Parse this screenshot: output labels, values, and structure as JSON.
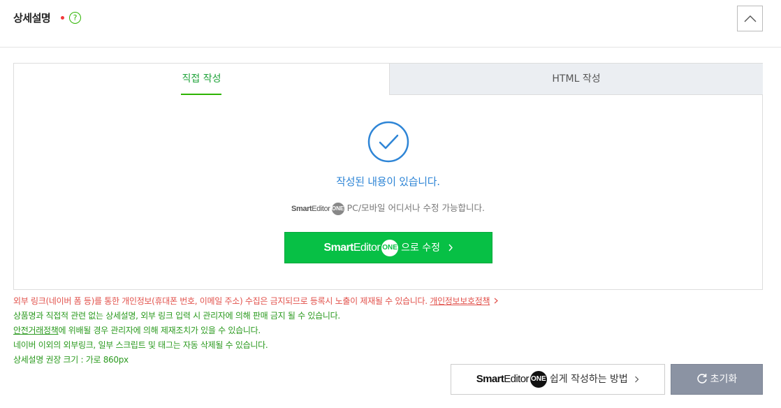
{
  "section": {
    "title": "상세설명",
    "help_symbol": "?"
  },
  "tabs": [
    {
      "label": "직접 작성",
      "active": true
    },
    {
      "label": "HTML 작성",
      "active": false
    }
  ],
  "editor": {
    "status_text": "작성된 내용이 있습니다.",
    "brand_bold": "Smart",
    "brand_light": "Editor",
    "brand_badge": "ONE",
    "sub_text": "PC/모바일 어디서나 수정 가능합니다.",
    "edit_button_suffix": "으로 수정"
  },
  "notices": {
    "red_text": "외부 링크(네이버 폼 등)를 통한 개인정보(휴대폰 번호, 이메일 주소) 수집은 금지되므로 등록시 노출이 제재될 수 있습니다.",
    "red_link": "개인정보보호정책",
    "line2": "상품명과 직접적 관련 없는 상세설명, 외부 링크 입력 시 관리자에 의해 판매 금지 될 수 있습니다.",
    "line3_link": "안전거래정책",
    "line3_rest": "에 위배될 경우 관리자에 의해 제재조치가 있을 수 있습니다.",
    "line4": "네이버 이외의 외부링크, 일부 스크립트 및 태그는 자동 삭제될 수 있습니다.",
    "line5": "상세설명 권장 크기 : 가로 860px"
  },
  "footer": {
    "howto_suffix": "쉽게 작성하는 방법",
    "reset_label": "초기화"
  },
  "colors": {
    "accent_green": "#07c045",
    "status_blue": "#2e85d6",
    "notice_red": "#e2524c",
    "reset_gray": "#8b93a3"
  }
}
